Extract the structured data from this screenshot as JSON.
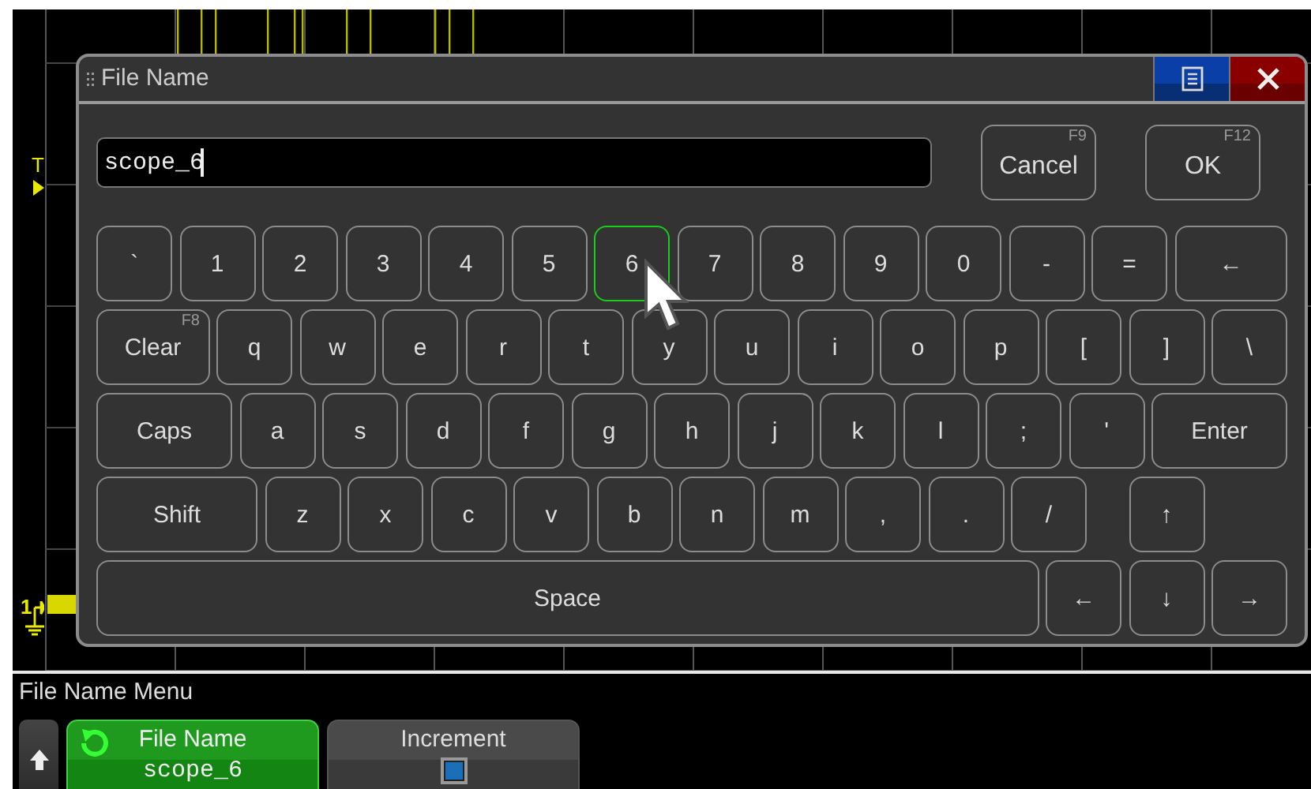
{
  "scope": {
    "trigger_marker": "T",
    "channel_marker": "1"
  },
  "dialog": {
    "title": "File Name",
    "field": {
      "value": "scope_6"
    },
    "actions": [
      {
        "label": "Cancel",
        "shortcut": "F9"
      },
      {
        "label": "OK",
        "shortcut": "F12"
      }
    ],
    "keyboard": [
      {
        "keys": [
          {
            "label": "`",
            "kind": "char",
            "selected": false
          },
          {
            "label": "1",
            "kind": "char",
            "selected": false
          },
          {
            "label": "2",
            "kind": "char",
            "selected": false
          },
          {
            "label": "3",
            "kind": "char",
            "selected": false
          },
          {
            "label": "4",
            "kind": "char",
            "selected": false
          },
          {
            "label": "5",
            "kind": "char",
            "selected": false
          },
          {
            "label": "6",
            "kind": "char",
            "selected": true
          },
          {
            "label": "7",
            "kind": "char",
            "selected": false
          },
          {
            "label": "8",
            "kind": "char",
            "selected": false
          },
          {
            "label": "9",
            "kind": "char",
            "selected": false
          },
          {
            "label": "0",
            "kind": "char",
            "selected": false
          },
          {
            "label": "-",
            "kind": "char",
            "selected": false
          },
          {
            "label": "=",
            "kind": "char",
            "selected": false
          },
          {
            "label": "←",
            "kind": "wide",
            "selected": false
          }
        ]
      },
      {
        "keys": [
          {
            "label": "Clear",
            "kind": "wide",
            "shortcut": "F8",
            "selected": false
          },
          {
            "label": "q",
            "kind": "char",
            "selected": false
          },
          {
            "label": "w",
            "kind": "char",
            "selected": false
          },
          {
            "label": "e",
            "kind": "char",
            "selected": false
          },
          {
            "label": "r",
            "kind": "char",
            "selected": false
          },
          {
            "label": "t",
            "kind": "char",
            "selected": false
          },
          {
            "label": "y",
            "kind": "char",
            "selected": false
          },
          {
            "label": "u",
            "kind": "char",
            "selected": false
          },
          {
            "label": "i",
            "kind": "char",
            "selected": false
          },
          {
            "label": "o",
            "kind": "char",
            "selected": false
          },
          {
            "label": "p",
            "kind": "char",
            "selected": false
          },
          {
            "label": "[",
            "kind": "char",
            "selected": false
          },
          {
            "label": "]",
            "kind": "char",
            "selected": false
          },
          {
            "label": "\\",
            "kind": "char",
            "selected": false
          }
        ]
      },
      {
        "keys": [
          {
            "label": "Caps",
            "kind": "wide",
            "selected": false
          },
          {
            "label": "a",
            "kind": "char",
            "selected": false
          },
          {
            "label": "s",
            "kind": "char",
            "selected": false
          },
          {
            "label": "d",
            "kind": "char",
            "selected": false
          },
          {
            "label": "f",
            "kind": "char",
            "selected": false
          },
          {
            "label": "g",
            "kind": "char",
            "selected": false
          },
          {
            "label": "h",
            "kind": "char",
            "selected": false
          },
          {
            "label": "j",
            "kind": "char",
            "selected": false
          },
          {
            "label": "k",
            "kind": "char",
            "selected": false
          },
          {
            "label": "l",
            "kind": "char",
            "selected": false
          },
          {
            "label": ";",
            "kind": "char",
            "selected": false
          },
          {
            "label": "'",
            "kind": "char",
            "selected": false
          },
          {
            "label": "Enter",
            "kind": "wide",
            "selected": false
          }
        ]
      },
      {
        "keys": [
          {
            "label": "Shift",
            "kind": "shift",
            "selected": false
          },
          {
            "label": "z",
            "kind": "char",
            "selected": false
          },
          {
            "label": "x",
            "kind": "char",
            "selected": false
          },
          {
            "label": "c",
            "kind": "char",
            "selected": false
          },
          {
            "label": "v",
            "kind": "char",
            "selected": false
          },
          {
            "label": "b",
            "kind": "char",
            "selected": false
          },
          {
            "label": "n",
            "kind": "char",
            "selected": false
          },
          {
            "label": "m",
            "kind": "char",
            "selected": false
          },
          {
            "label": ",",
            "kind": "char",
            "selected": false
          },
          {
            "label": ".",
            "kind": "char",
            "selected": false
          },
          {
            "label": "/",
            "kind": "char",
            "selected": false
          },
          {
            "label": "↑",
            "kind": "arrow",
            "selected": false
          }
        ]
      },
      {
        "keys": [
          {
            "label": "Space",
            "kind": "space",
            "selected": false
          },
          {
            "label": "←",
            "kind": "arrow",
            "selected": false
          },
          {
            "label": "↓",
            "kind": "arrow",
            "selected": false
          },
          {
            "label": "→",
            "kind": "arrow",
            "selected": false
          }
        ]
      }
    ]
  },
  "menu": {
    "title": "File Name Menu",
    "softkeys": [
      {
        "kind": "value",
        "label": "File Name",
        "value": "scope_6",
        "selected": true
      },
      {
        "kind": "checkbox",
        "label": "Increment",
        "checked": true,
        "selected": false
      }
    ]
  }
}
